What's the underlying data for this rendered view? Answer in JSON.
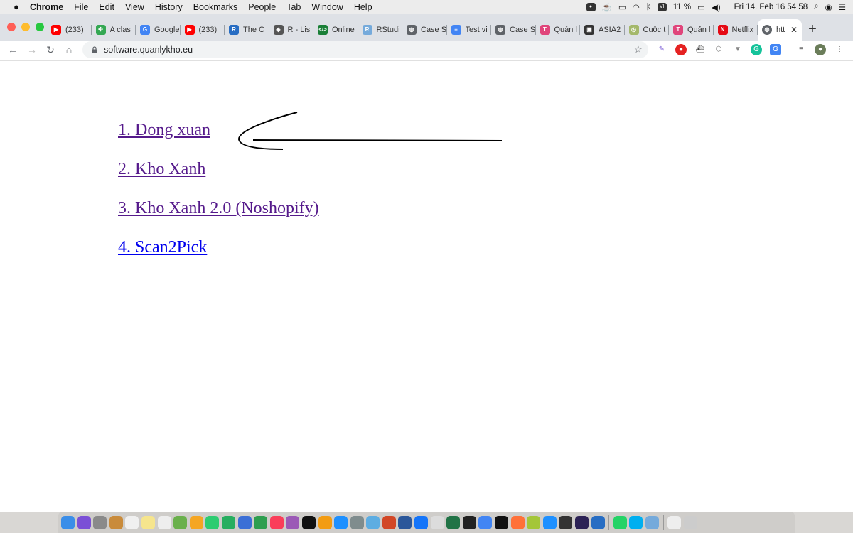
{
  "menubar": {
    "apple": "",
    "items": [
      "Chrome",
      "File",
      "Edit",
      "View",
      "History",
      "Bookmarks",
      "People",
      "Tab",
      "Window",
      "Help"
    ],
    "battery": "11 %",
    "datetime": "Fri 14. Feb  16 54 58",
    "keyboard": "VI"
  },
  "tabs": [
    {
      "title": "(233)",
      "icon": "youtube-icon",
      "color": "#ff0000",
      "glyph": "▶"
    },
    {
      "title": "A clas",
      "icon": "app-icon",
      "color": "#34a853",
      "glyph": "✣"
    },
    {
      "title": "Google",
      "icon": "google-translate-icon",
      "color": "#4285f4",
      "glyph": "G"
    },
    {
      "title": "(233)",
      "icon": "youtube-icon",
      "color": "#ff0000",
      "glyph": "▶"
    },
    {
      "title": "The C",
      "icon": "r-icon",
      "color": "#276dc3",
      "glyph": "R"
    },
    {
      "title": "R - Lis",
      "icon": "diamond-icon",
      "color": "#555555",
      "glyph": "◈"
    },
    {
      "title": "Online",
      "icon": "code-icon",
      "color": "#1a7f37",
      "glyph": "</>"
    },
    {
      "title": "RStudi",
      "icon": "rstudio-icon",
      "color": "#75aadb",
      "glyph": "R"
    },
    {
      "title": "Case S",
      "icon": "globe-icon",
      "color": "#5f6368",
      "glyph": "◍"
    },
    {
      "title": "Test vi",
      "icon": "google-docs-icon",
      "color": "#4285f4",
      "glyph": "≡"
    },
    {
      "title": "Case S",
      "icon": "globe-icon",
      "color": "#5f6368",
      "glyph": "◍"
    },
    {
      "title": "Quản l",
      "icon": "t-icon",
      "color": "#e0457b",
      "glyph": "T"
    },
    {
      "title": "ASIA2",
      "icon": "trello-icon",
      "color": "#333333",
      "glyph": "▣"
    },
    {
      "title": "Cuộc t",
      "icon": "clock-icon",
      "color": "#a4b86b",
      "glyph": "◷"
    },
    {
      "title": "Quản l",
      "icon": "t-icon",
      "color": "#e0457b",
      "glyph": "T"
    },
    {
      "title": "Netflix",
      "icon": "netflix-icon",
      "color": "#e50914",
      "glyph": "N"
    }
  ],
  "active_tab": {
    "title": "htt",
    "icon": "globe-icon",
    "close": "✕"
  },
  "new_tab": "+",
  "toolbar": {
    "back": "←",
    "forward": "→",
    "reload": "↻",
    "home": "⌂",
    "url": "software.quanlykho.eu",
    "star": "☆"
  },
  "links": [
    {
      "label": "1. Dong xuan",
      "visited": true
    },
    {
      "label": "2. Kho Xanh",
      "visited": true
    },
    {
      "label": "3. Kho Xanh 2.0 (Noshopify)",
      "visited": true
    },
    {
      "label": "4. Scan2Pick",
      "visited": false
    }
  ],
  "colors": {
    "visited_link": "#551a8b",
    "unvisited_link": "#0000ee",
    "tab_strip": "#dee1e6",
    "omnibox": "#f1f3f4"
  },
  "dock": [
    "finder-icon",
    "siri-icon",
    "launchpad-icon",
    "preview-icon",
    "calendar-icon",
    "notes-icon",
    "reminders-icon",
    "maps-icon",
    "photos-icon",
    "messages-icon",
    "facetime-icon",
    "keynote-icon",
    "numbers-icon",
    "music-icon",
    "podcasts-icon",
    "tv-icon",
    "books-icon",
    "app-store-icon",
    "system-preferences-icon",
    "finder-window-icon",
    "powerpoint-icon",
    "word-icon",
    "xcode-icon",
    "box-icon",
    "excel-icon",
    "terminal-icon",
    "chrome-icon",
    "phpstorm-icon",
    "firefox-icon",
    "android-icon",
    "safari-icon",
    "github-icon",
    "eclipse-icon",
    "r-icon",
    "whatsapp-icon",
    "skype-icon",
    "rstudio-icon",
    "documents-icon",
    "trash-icon"
  ]
}
